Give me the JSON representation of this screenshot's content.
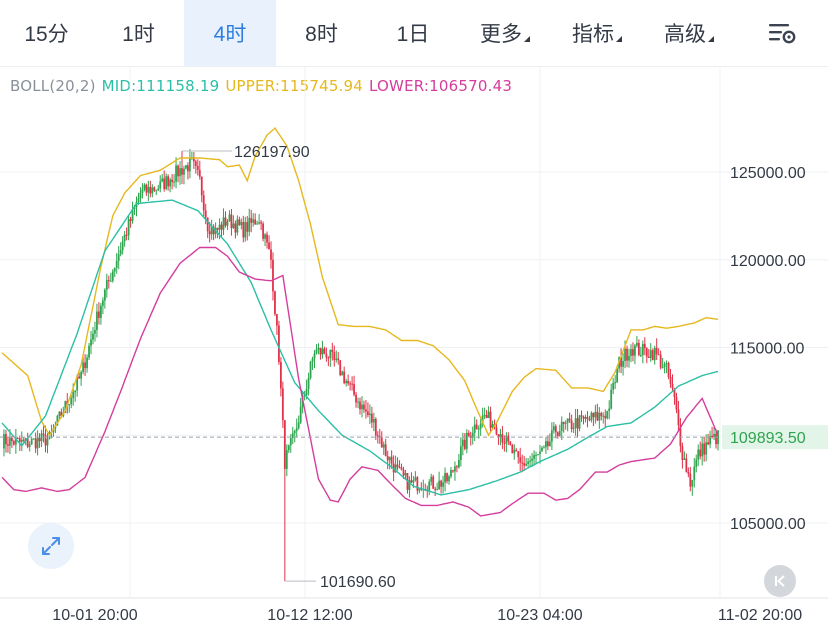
{
  "tabs": [
    {
      "label": "15分"
    },
    {
      "label": "1时"
    },
    {
      "label": "4时"
    },
    {
      "label": "8时"
    },
    {
      "label": "1日"
    },
    {
      "label": "更多"
    },
    {
      "label": "指标"
    },
    {
      "label": "高级"
    }
  ],
  "active_tab": "4时",
  "indicator": {
    "name": "BOLL(20,2)",
    "mid": "MID:111158.19",
    "upper": "UPPER:115745.94",
    "lower": "LOWER:106570.43"
  },
  "colors": {
    "up": "#2ea44f",
    "down": "#e0334a",
    "mid": "#2bbfa6",
    "upper": "#e6b81e",
    "lower": "#d43d9c",
    "accent": "#2e7de1"
  },
  "chart_data": {
    "type": "candlestick",
    "y_ticks": [
      "125000.00",
      "120000.00",
      "115000.00",
      "105000.00"
    ],
    "x_ticks": [
      "10-01 20:00",
      "10-12 12:00",
      "10-23 04:00",
      "11-02 20:00"
    ],
    "ylim": [
      101000,
      128500
    ],
    "last_price": 109893.5,
    "last_price_label": "109893.50",
    "max_label": "126197.90",
    "min_label": "101690.60",
    "max_value": 126197.9,
    "min_value": 101690.6,
    "grid": true,
    "mid_anchors": [
      [
        0,
        110700
      ],
      [
        10,
        109400
      ],
      [
        22,
        111100
      ],
      [
        38,
        115800
      ],
      [
        52,
        120500
      ],
      [
        68,
        123200
      ],
      [
        86,
        123400
      ],
      [
        99,
        122800
      ],
      [
        114,
        120900
      ],
      [
        126,
        118700
      ],
      [
        136,
        116000
      ],
      [
        148,
        113000
      ],
      [
        160,
        111400
      ],
      [
        172,
        110000
      ],
      [
        186,
        109100
      ],
      [
        198,
        108100
      ],
      [
        208,
        107100
      ],
      [
        222,
        106600
      ],
      [
        236,
        106900
      ],
      [
        250,
        107400
      ],
      [
        262,
        107900
      ],
      [
        272,
        108500
      ],
      [
        286,
        109200
      ],
      [
        298,
        110000
      ],
      [
        306,
        110500
      ],
      [
        318,
        110700
      ],
      [
        330,
        111600
      ],
      [
        342,
        112800
      ],
      [
        354,
        113400
      ],
      [
        364,
        113700
      ],
      [
        374,
        113700
      ],
      [
        384,
        112800
      ]
    ],
    "upper_anchors": [
      [
        0,
        114700
      ],
      [
        6,
        114100
      ],
      [
        13,
        113400
      ],
      [
        20,
        110800
      ],
      [
        24,
        110000
      ],
      [
        32,
        111400
      ],
      [
        40,
        114000
      ],
      [
        50,
        119600
      ],
      [
        56,
        122500
      ],
      [
        62,
        123800
      ],
      [
        70,
        124800
      ],
      [
        80,
        125100
      ],
      [
        90,
        125800
      ],
      [
        100,
        125800
      ],
      [
        110,
        125700
      ],
      [
        114,
        125300
      ],
      [
        120,
        125400
      ],
      [
        124,
        124500
      ],
      [
        128,
        125900
      ],
      [
        134,
        127100
      ],
      [
        138,
        127500
      ],
      [
        144,
        126500
      ],
      [
        150,
        124500
      ],
      [
        156,
        122000
      ],
      [
        162,
        119000
      ],
      [
        170,
        116300
      ],
      [
        178,
        116200
      ],
      [
        186,
        116200
      ],
      [
        194,
        116000
      ],
      [
        202,
        115400
      ],
      [
        210,
        115400
      ],
      [
        218,
        115100
      ],
      [
        226,
        114300
      ],
      [
        234,
        113100
      ],
      [
        240,
        111500
      ],
      [
        246,
        110000
      ],
      [
        250,
        110700
      ],
      [
        258,
        112500
      ],
      [
        264,
        113300
      ],
      [
        270,
        113800
      ],
      [
        280,
        113700
      ],
      [
        288,
        112700
      ],
      [
        296,
        112700
      ],
      [
        304,
        112500
      ],
      [
        310,
        113600
      ],
      [
        318,
        116000
      ],
      [
        324,
        116000
      ],
      [
        330,
        116200
      ],
      [
        336,
        116100
      ],
      [
        342,
        116200
      ],
      [
        350,
        116400
      ],
      [
        356,
        116700
      ],
      [
        362,
        116600
      ],
      [
        370,
        116600
      ],
      [
        376,
        116000
      ],
      [
        382,
        115800
      ]
    ],
    "lower_anchors": [
      [
        0,
        107600
      ],
      [
        6,
        106900
      ],
      [
        12,
        106800
      ],
      [
        20,
        107000
      ],
      [
        28,
        106800
      ],
      [
        34,
        106900
      ],
      [
        42,
        107600
      ],
      [
        52,
        110200
      ],
      [
        60,
        112500
      ],
      [
        70,
        115500
      ],
      [
        80,
        118100
      ],
      [
        90,
        119800
      ],
      [
        100,
        120700
      ],
      [
        108,
        120700
      ],
      [
        114,
        120200
      ],
      [
        120,
        119300
      ],
      [
        128,
        118900
      ],
      [
        136,
        118800
      ],
      [
        142,
        119100
      ],
      [
        150,
        113200
      ],
      [
        160,
        107500
      ],
      [
        166,
        106300
      ],
      [
        170,
        106200
      ],
      [
        176,
        107500
      ],
      [
        182,
        108200
      ],
      [
        190,
        108000
      ],
      [
        196,
        107300
      ],
      [
        204,
        106400
      ],
      [
        212,
        106000
      ],
      [
        220,
        106000
      ],
      [
        228,
        106200
      ],
      [
        236,
        105900
      ],
      [
        242,
        105400
      ],
      [
        252,
        105600
      ],
      [
        258,
        106100
      ],
      [
        266,
        106700
      ],
      [
        274,
        106700
      ],
      [
        280,
        106300
      ],
      [
        286,
        106400
      ],
      [
        292,
        106900
      ],
      [
        300,
        107900
      ],
      [
        306,
        107900
      ],
      [
        312,
        108300
      ],
      [
        318,
        108500
      ],
      [
        324,
        108600
      ],
      [
        330,
        108700
      ],
      [
        338,
        109500
      ],
      [
        346,
        111000
      ],
      [
        354,
        112100
      ],
      [
        362,
        110000
      ],
      [
        368,
        106800
      ],
      [
        374,
        106700
      ],
      [
        382,
        106600
      ]
    ],
    "close_anchors": [
      [
        0,
        109700
      ],
      [
        12,
        109550
      ],
      [
        24,
        109800
      ],
      [
        30,
        111200
      ],
      [
        40,
        113400
      ],
      [
        50,
        117500
      ],
      [
        60,
        120700
      ],
      [
        70,
        123800
      ],
      [
        80,
        124200
      ],
      [
        90,
        125100
      ],
      [
        96,
        125500
      ],
      [
        100,
        124500
      ],
      [
        104,
        122000
      ],
      [
        108,
        121600
      ],
      [
        114,
        122300
      ],
      [
        122,
        121700
      ],
      [
        130,
        122400
      ],
      [
        136,
        120000
      ],
      [
        140,
        114500
      ],
      [
        143,
        108500
      ],
      [
        148,
        110000
      ],
      [
        152,
        111900
      ],
      [
        158,
        114800
      ],
      [
        164,
        114700
      ],
      [
        170,
        113900
      ],
      [
        176,
        112700
      ],
      [
        182,
        111600
      ],
      [
        188,
        110700
      ],
      [
        194,
        109000
      ],
      [
        200,
        107900
      ],
      [
        206,
        107200
      ],
      [
        212,
        107300
      ],
      [
        220,
        107200
      ],
      [
        226,
        107500
      ],
      [
        232,
        109100
      ],
      [
        238,
        110400
      ],
      [
        244,
        111100
      ],
      [
        250,
        110500
      ],
      [
        256,
        109400
      ],
      [
        262,
        108300
      ],
      [
        268,
        108600
      ],
      [
        274,
        109000
      ],
      [
        280,
        110300
      ],
      [
        290,
        110700
      ],
      [
        300,
        111000
      ],
      [
        306,
        111300
      ],
      [
        312,
        114100
      ],
      [
        318,
        115000
      ],
      [
        324,
        114800
      ],
      [
        330,
        114700
      ],
      [
        336,
        113700
      ],
      [
        340,
        112000
      ],
      [
        344,
        109000
      ],
      [
        348,
        107300
      ],
      [
        352,
        108900
      ],
      [
        358,
        109700
      ],
      [
        362,
        109900
      ]
    ],
    "n_candles": 363
  }
}
